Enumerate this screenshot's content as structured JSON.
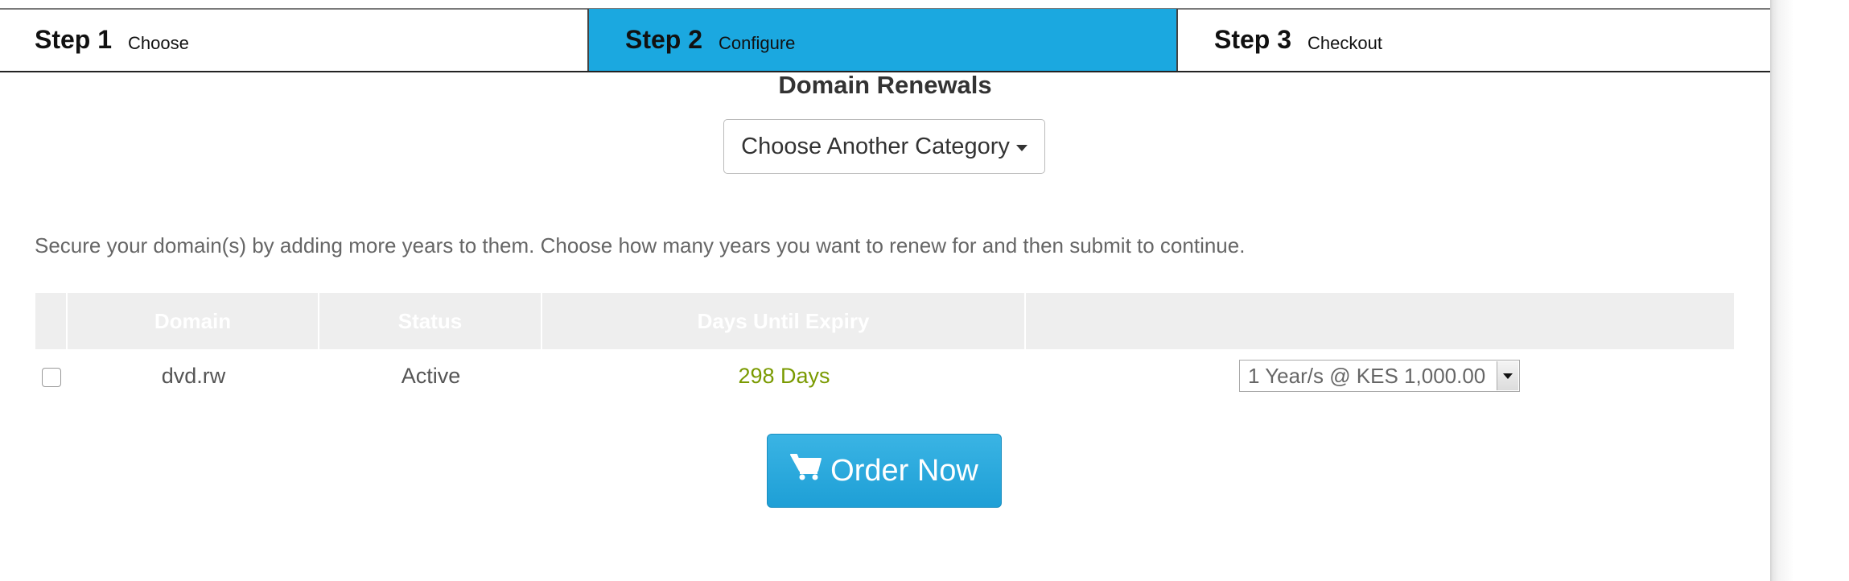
{
  "steps": [
    {
      "number": "Step 1",
      "label": "Choose"
    },
    {
      "number": "Step 2",
      "label": "Configure"
    },
    {
      "number": "Step 3",
      "label": "Checkout"
    }
  ],
  "active_step_color": "#1ba8e0",
  "section_title": "Domain Renewals",
  "category_button": {
    "label": "Choose Another Category",
    "icon": "caret-down-icon"
  },
  "intro_text": "Secure your domain(s) by adding more years to them. Choose how many years you want to renew for and then submit to continue.",
  "table": {
    "headers": [
      "Domain",
      "Status",
      "Days Until Expiry",
      ""
    ],
    "rows": [
      {
        "checked": false,
        "domain": "dvd.rw",
        "status": "Active",
        "expiry": "298 Days",
        "term": "1 Year/s @ KES 1,000.00"
      }
    ]
  },
  "expiry_color": "#7a9a01",
  "order_button": {
    "label": "Order Now",
    "icon": "shopping-cart-icon"
  }
}
